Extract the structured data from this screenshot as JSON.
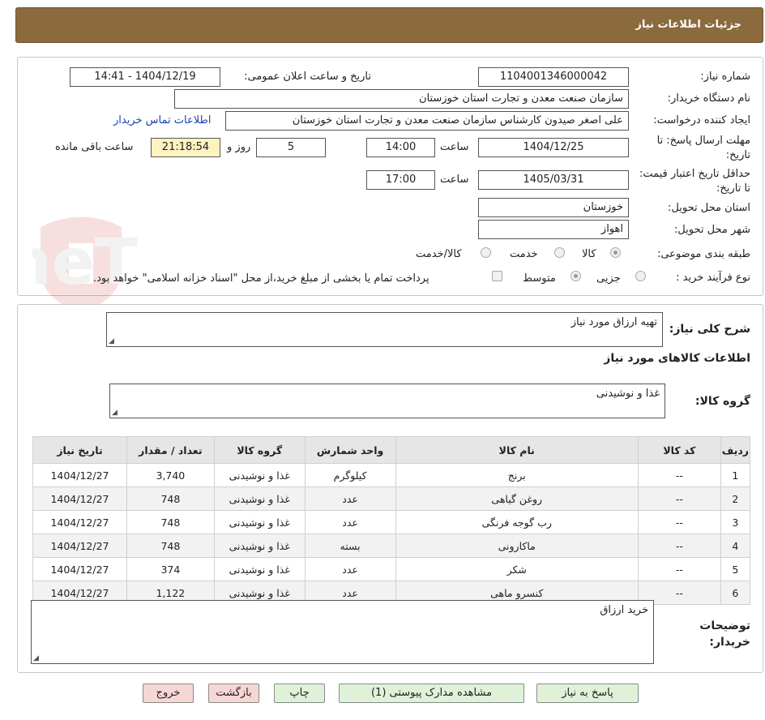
{
  "header": {
    "title": "جزئیات اطلاعات نیاز"
  },
  "form": {
    "need_number_label": "شماره نیاز:",
    "need_number": "1104001346000042",
    "announce_label": "تاریخ و ساعت اعلان عمومی:",
    "announce_value": "1404/12/19 - 14:41",
    "buyer_org_label": "نام دستگاه خریدار:",
    "buyer_org": "سازمان صنعت معدن و تجارت استان خوزستان",
    "requester_label": "ایجاد کننده درخواست:",
    "requester": "علی اصغر صیدون کارشناس سازمان صنعت معدن و تجارت استان خوزستان",
    "contact_link": "اطلاعات تماس خریدار",
    "deadline_label": "مهلت ارسال پاسخ: تا تاریخ:",
    "deadline_date": "1404/12/25",
    "time_label": "ساعت",
    "deadline_time": "14:00",
    "days_value": "5",
    "days_label": "روز و",
    "remaining_time": "21:18:54",
    "remaining_label": "ساعت باقی مانده",
    "validity_label": "حداقل تاریخ اعتبار قیمت: تا تاریخ:",
    "validity_date": "1405/03/31",
    "validity_time": "17:00",
    "province_label": "استان محل تحویل:",
    "province": "خوزستان",
    "city_label": "شهر محل تحویل:",
    "city": "اهواز",
    "category_label": "طبقه بندی موضوعی:",
    "category_options": [
      "کالا",
      "خدمت",
      "کالا/خدمت"
    ],
    "process_label": "نوع فرآیند خرید :",
    "process_options": [
      "جزیی",
      "متوسط"
    ],
    "payment_note": "پرداخت تمام یا بخشی از مبلغ خرید،از محل \"اسناد خزانه اسلامی\" خواهد بود."
  },
  "details": {
    "summary_label": "شرح کلی نیاز:",
    "summary": "تهیه ارزاق مورد نیاز",
    "goods_title": "اطلاعات کالاهای مورد نیاز",
    "group_label": "گروه کالا:",
    "group": "غذا و نوشیدنی",
    "table": {
      "headers": [
        "ردیف",
        "کد کالا",
        "نام کالا",
        "واحد شمارش",
        "گروه کالا",
        "تعداد / مقدار",
        "تاریخ نیاز"
      ],
      "rows": [
        [
          "1",
          "--",
          "برنج",
          "کیلوگرم",
          "غذا و نوشیدنی",
          "3,740",
          "1404/12/27"
        ],
        [
          "2",
          "--",
          "روغن گیاهی",
          "عدد",
          "غذا و نوشیدنی",
          "748",
          "1404/12/27"
        ],
        [
          "3",
          "--",
          "رب گوجه فرنگی",
          "عدد",
          "غذا و نوشیدنی",
          "748",
          "1404/12/27"
        ],
        [
          "4",
          "--",
          "ماکارونی",
          "بسته",
          "غذا و نوشیدنی",
          "748",
          "1404/12/27"
        ],
        [
          "5",
          "--",
          "شکر",
          "عدد",
          "غذا و نوشیدنی",
          "374",
          "1404/12/27"
        ],
        [
          "6",
          "--",
          "کنسرو ماهی",
          "عدد",
          "غذا و نوشیدنی",
          "1,122",
          "1404/12/27"
        ]
      ]
    },
    "notes_label": "توضیحات خریدار:",
    "notes": "خرید ارزاق"
  },
  "buttons": {
    "reply": "پاسخ به نیاز",
    "attachments": "مشاهده مدارک پیوستی (1)",
    "print": "چاپ",
    "back": "بازگشت",
    "exit": "خروج"
  },
  "watermark": {
    "text": "AriaTender.neT"
  }
}
